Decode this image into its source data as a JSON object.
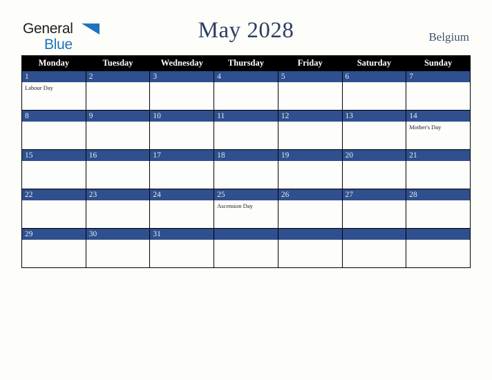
{
  "brand": {
    "name_part1": "General",
    "name_part2": "Blue",
    "triangle_color": "#1e73be"
  },
  "header": {
    "title": "May 2028",
    "country": "Belgium",
    "title_color": "#2c3e63"
  },
  "calendar": {
    "weekday_headers": [
      "Monday",
      "Tuesday",
      "Wednesday",
      "Thursday",
      "Friday",
      "Saturday",
      "Sunday"
    ],
    "header_bg": "#000000",
    "daynum_bg": "#2f4f8e",
    "cell_bg": "#fdfdfb",
    "weeks": [
      [
        {
          "day": "1",
          "events": [
            "Labour Day"
          ]
        },
        {
          "day": "2",
          "events": []
        },
        {
          "day": "3",
          "events": []
        },
        {
          "day": "4",
          "events": []
        },
        {
          "day": "5",
          "events": []
        },
        {
          "day": "6",
          "events": []
        },
        {
          "day": "7",
          "events": []
        }
      ],
      [
        {
          "day": "8",
          "events": []
        },
        {
          "day": "9",
          "events": []
        },
        {
          "day": "10",
          "events": []
        },
        {
          "day": "11",
          "events": []
        },
        {
          "day": "12",
          "events": []
        },
        {
          "day": "13",
          "events": []
        },
        {
          "day": "14",
          "events": [
            "Mother's Day"
          ]
        }
      ],
      [
        {
          "day": "15",
          "events": []
        },
        {
          "day": "16",
          "events": []
        },
        {
          "day": "17",
          "events": []
        },
        {
          "day": "18",
          "events": []
        },
        {
          "day": "19",
          "events": []
        },
        {
          "day": "20",
          "events": []
        },
        {
          "day": "21",
          "events": []
        }
      ],
      [
        {
          "day": "22",
          "events": []
        },
        {
          "day": "23",
          "events": []
        },
        {
          "day": "24",
          "events": []
        },
        {
          "day": "25",
          "events": [
            "Ascension Day"
          ]
        },
        {
          "day": "26",
          "events": []
        },
        {
          "day": "27",
          "events": []
        },
        {
          "day": "28",
          "events": []
        }
      ],
      [
        {
          "day": "29",
          "events": []
        },
        {
          "day": "30",
          "events": []
        },
        {
          "day": "31",
          "events": []
        },
        {
          "day": "",
          "events": []
        },
        {
          "day": "",
          "events": []
        },
        {
          "day": "",
          "events": []
        },
        {
          "day": "",
          "events": []
        }
      ]
    ]
  }
}
